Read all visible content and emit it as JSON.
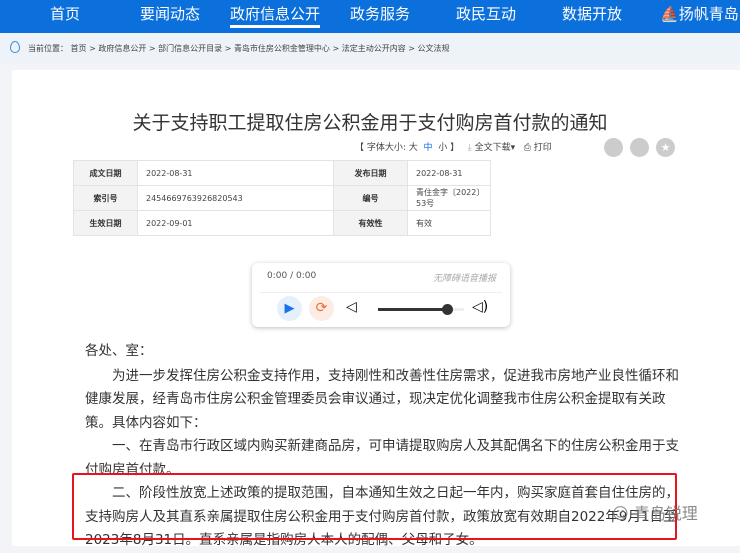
{
  "nav": [
    "首页",
    "要闻动态",
    "政府信息公开",
    "政务服务",
    "政民互动",
    "数据开放",
    "扬帆青岛"
  ],
  "breadcrumb": {
    "label": "当前位置：",
    "items": [
      "首页",
      "政府信息公开",
      "部门信息公开目录",
      "青岛市住房公积金管理中心",
      "法定主动公开内容",
      "公文法规"
    ]
  },
  "title": "关于支持职工提取住房公积金用于支付购房首付款的通知",
  "tools": {
    "font_label": "【 字体大小: 大",
    "mid": "中",
    "small": "小 】",
    "download": "全文下载",
    "print": "打印"
  },
  "meta": [
    {
      "k1": "成文日期",
      "v1": "2022-08-31",
      "k2": "发布日期",
      "v2": "2022-08-31"
    },
    {
      "k1": "索引号",
      "v1": "2454669763926820543",
      "k2": "编号",
      "v2": "青住金字〔2022〕53号"
    },
    {
      "k1": "生效日期",
      "v1": "2022-09-01",
      "k2": "有效性",
      "v2": "有效"
    }
  ],
  "player": {
    "time": "0:00 / 0:00",
    "label": "无障碍语音播报",
    "volume": 0.8
  },
  "body": {
    "greeting": "各处、室：",
    "p1": "为进一步发挥住房公积金支持作用，支持刚性和改善性住房需求，促进我市房地产业良性循环和健康发展，经青岛市住房公积金管理委员会审议通过，现决定优化调整我市住房公积金提取有关政策。具体内容如下：",
    "p2": "一、在青岛市行政区域内购买新建商品房，可申请提取购房人及其配偶名下的住房公积金用于支付购房首付款。",
    "p3": "二、阶段性放宽上述政策的提取范围，自本通知生效之日起一年内，购买家庭首套自住住房的，支持购房人及其直系亲属提取住房公积金用于支付购房首付款，政策放宽有效期自2022年9月1日至2023年8月31日。直系亲属是指购房人本人的配偶、父母和子女。"
  },
  "watermark": "青岛锐理"
}
